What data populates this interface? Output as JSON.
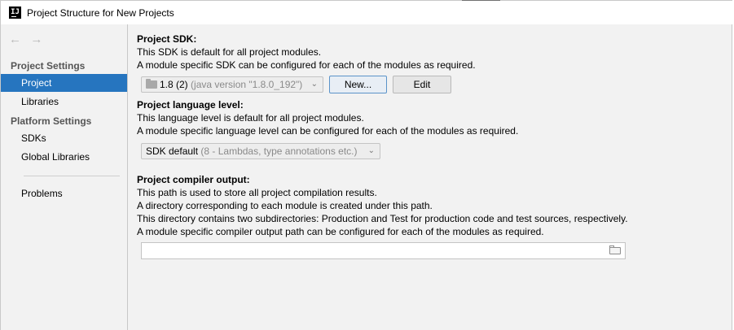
{
  "window": {
    "title": "Project Structure for New Projects",
    "app_icon": "IJ"
  },
  "nav": {
    "back_icon": "←",
    "forward_icon": "→"
  },
  "sidebar": {
    "project_settings_header": "Project Settings",
    "platform_settings_header": "Platform Settings",
    "items": [
      {
        "label": "Project",
        "selected": true
      },
      {
        "label": "Libraries",
        "selected": false
      },
      {
        "label": "SDKs",
        "selected": false
      },
      {
        "label": "Global Libraries",
        "selected": false
      },
      {
        "label": "Problems",
        "selected": false
      }
    ]
  },
  "sdk": {
    "heading": "Project SDK:",
    "line1": "This SDK is default for all project modules.",
    "line2": "A module specific SDK can be configured for each of the modules as required.",
    "combo_value": "1.8 (2)",
    "combo_detail": "(java version \"1.8.0_192\")",
    "new_button": "New...",
    "edit_button": "Edit"
  },
  "language": {
    "heading": "Project language level:",
    "line1": "This language level is default for all project modules.",
    "line2": "A module specific language level can be configured for each of the modules as required.",
    "combo_value": "SDK default",
    "combo_detail": "(8 - Lambdas, type annotations etc.)"
  },
  "compiler": {
    "heading": "Project compiler output:",
    "line1": "This path is used to store all project compilation results.",
    "line2": "A directory corresponding to each module is created under this path.",
    "line3": "This directory contains two subdirectories: Production and Test for production code and test sources, respectively.",
    "line4": "A module specific compiler output path can be configured for each of the modules as required.",
    "path_value": ""
  },
  "colors": {
    "selection": "#2675bf",
    "panel_bg": "#f2f2f2",
    "focus_border": "#5b93c9"
  }
}
